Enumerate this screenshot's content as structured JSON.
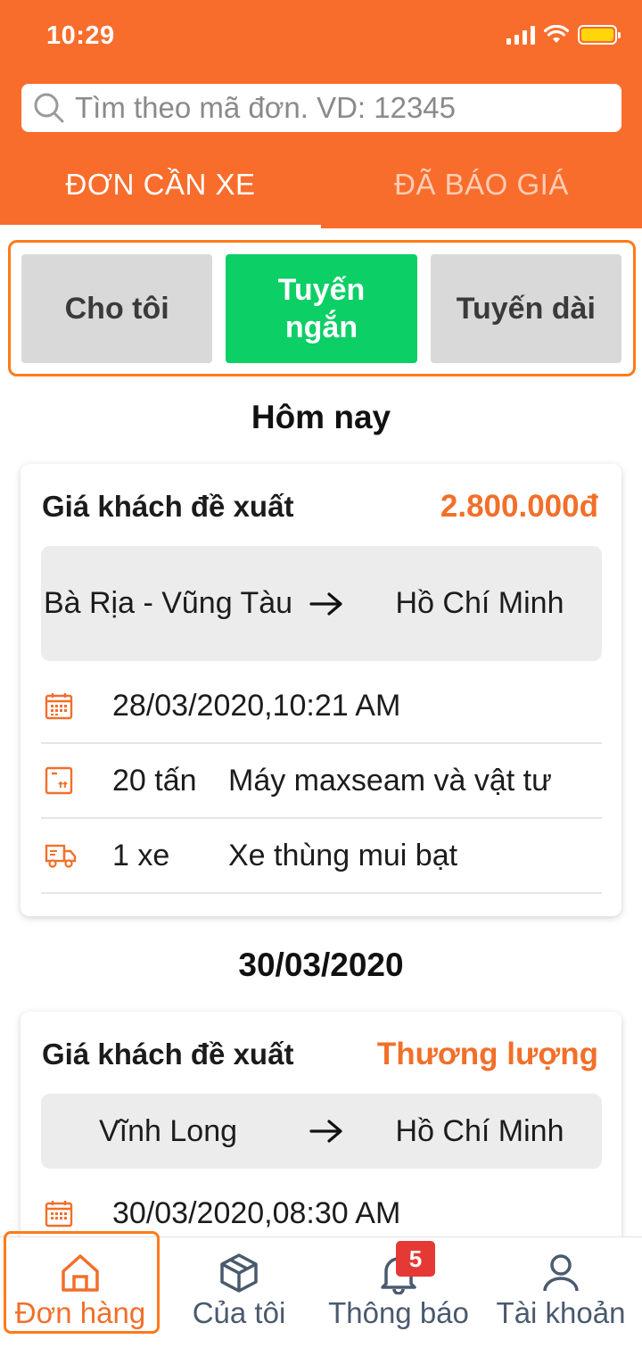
{
  "status_bar": {
    "time": "10:29"
  },
  "search": {
    "placeholder": "Tìm theo mã đơn. VD: 12345"
  },
  "tabs": [
    {
      "label": "ĐƠN CẦN XE",
      "active": true
    },
    {
      "label": "ĐÃ BÁO GIÁ",
      "active": false
    }
  ],
  "filters": [
    {
      "label": "Cho tôi",
      "active": false
    },
    {
      "label": "Tuyến ngắn",
      "active": true
    },
    {
      "label": "Tuyến dài",
      "active": false
    }
  ],
  "sections": [
    {
      "title": "Hôm nay",
      "card": {
        "label": "Giá khách đề xuất",
        "price": "2.800.000đ",
        "from": "Bà Rịa - Vũng Tàu",
        "to": "Hồ Chí Minh",
        "datetime": "28/03/2020,10:21 AM",
        "weight": "20 tấn",
        "goods": "Máy maxseam và vật tư",
        "vehicle_count": "1 xe",
        "vehicle_type": "Xe thùng mui bạt"
      }
    },
    {
      "title": "30/03/2020",
      "card": {
        "label": "Giá khách đề xuất",
        "price": "Thương lượng",
        "from": "Vĩnh Long",
        "to": "Hồ Chí Minh",
        "datetime": "30/03/2020,08:30 AM"
      }
    }
  ],
  "bottom_nav": [
    {
      "label": "Đơn hàng",
      "icon": "home-icon",
      "active": true
    },
    {
      "label": "Của tôi",
      "icon": "box-icon",
      "active": false
    },
    {
      "label": "Thông báo",
      "icon": "bell-icon",
      "badge": "5",
      "active": false
    },
    {
      "label": "Tài khoản",
      "icon": "user-icon",
      "active": false
    }
  ],
  "colors": {
    "brand": "#f96d2c",
    "accent_green": "#0ccf66",
    "price": "#f26f2a",
    "badge": "#e53935"
  }
}
